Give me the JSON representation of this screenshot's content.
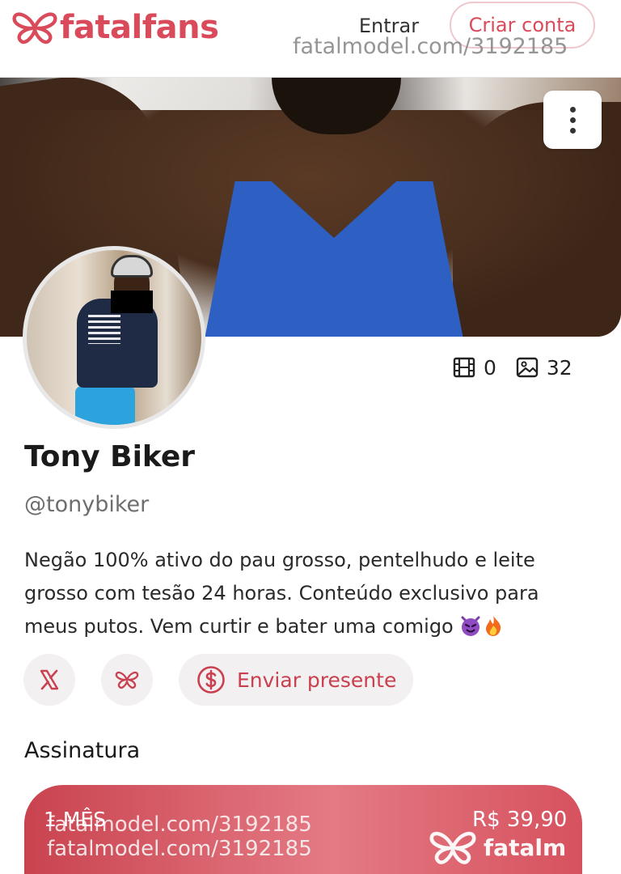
{
  "header": {
    "logo_text": "fatalfans",
    "login_label": "Entrar",
    "signup_label": "Criar conta",
    "watermark": "fatalmodel.com/3192185"
  },
  "profile": {
    "name": "Tony Biker",
    "handle": "@tonybiker",
    "bio": "Negão 100% ativo do pau grosso, pentelhudo e leite grosso com tesão 24 horas. Conteúdo exclusivo para meus putos. Vem curtir e bater uma comigo",
    "stats": {
      "videos": "0",
      "photos": "32"
    }
  },
  "actions": {
    "twitter_icon": "x-logo-icon",
    "fatal_icon": "fatal-butterfly-icon",
    "gift_label": "Enviar presente"
  },
  "subscription": {
    "title": "Assinatura",
    "period": "1 MÊS",
    "price": "R$ 39,90"
  },
  "watermarks": {
    "line1": "fatalmodel.com/3192185",
    "line2": "fatalmodel.com/3192185",
    "logo_text": "fatalm"
  },
  "colors": {
    "brand": "#d94b5a",
    "accent_dark": "#c9404f",
    "button_bg": "#f2f0f0"
  }
}
